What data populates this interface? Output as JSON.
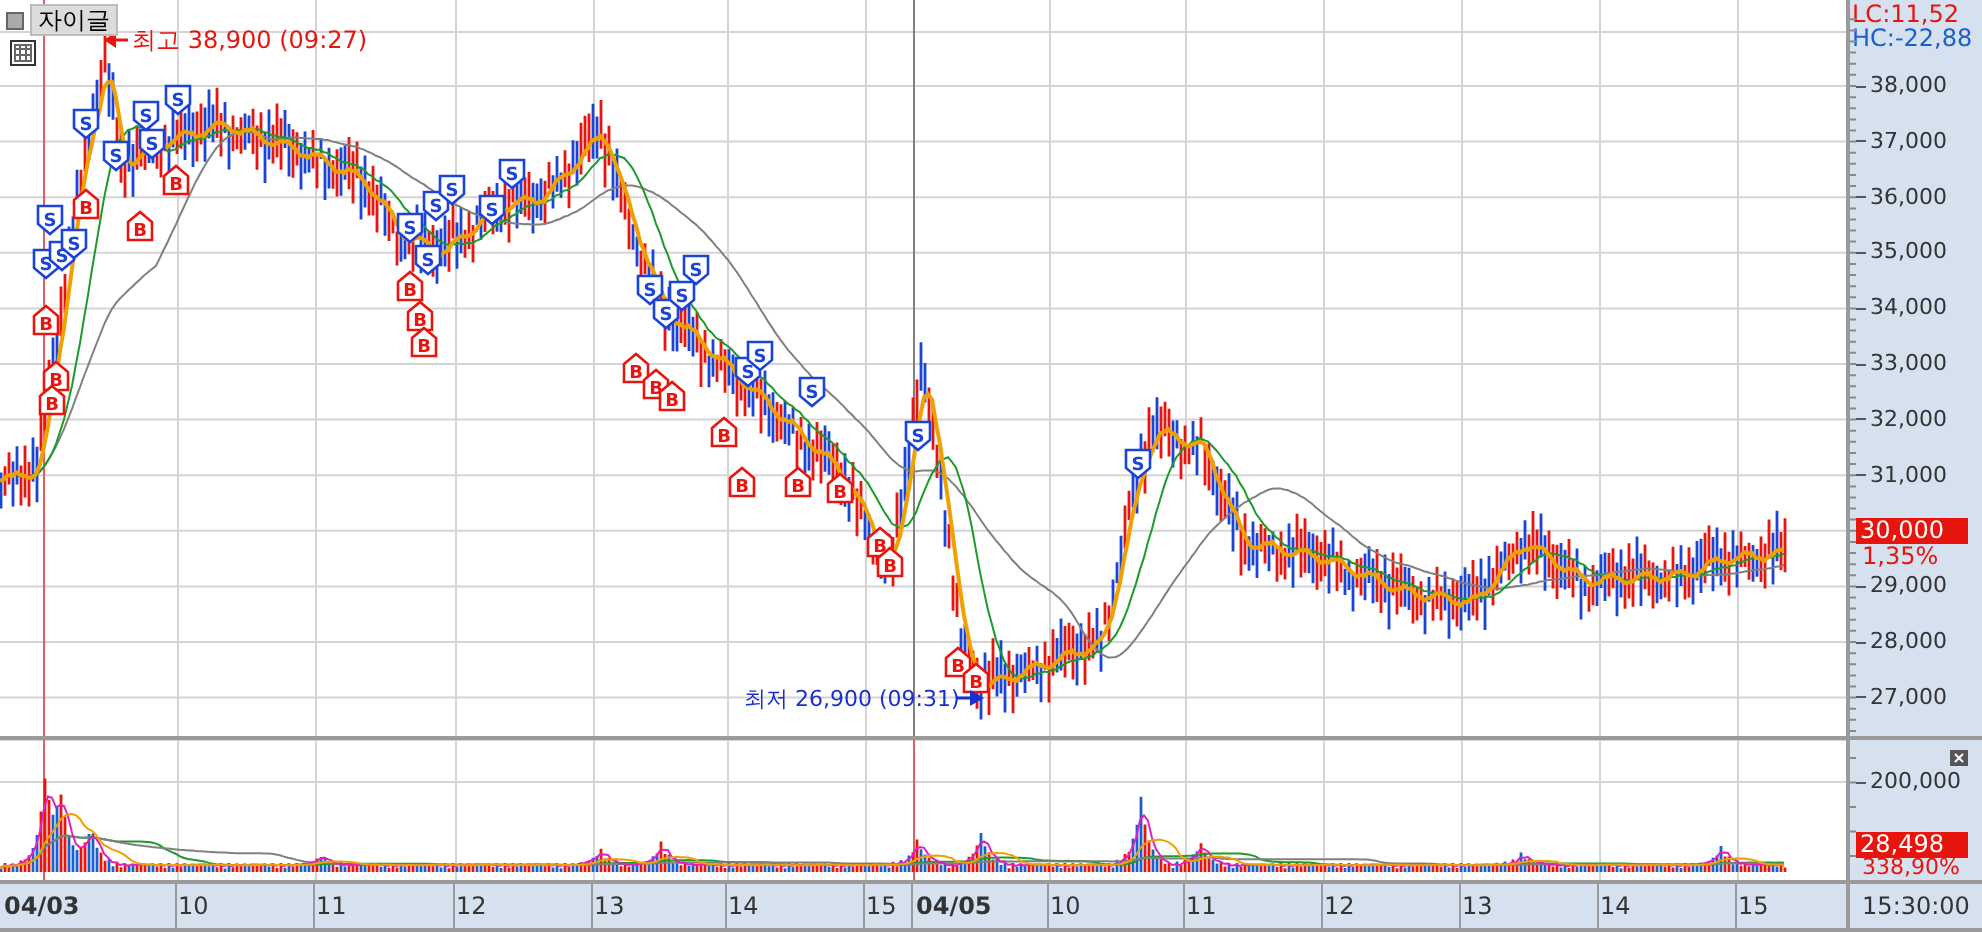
{
  "title": "자이글",
  "high_note": {
    "label": "최고 38,900 (09:27)"
  },
  "low_note": {
    "label": "최저 26,900 (09:31)"
  },
  "lc": "LC:11,52",
  "hc": "HC:-22,88",
  "price_axis": {
    "ticks": [
      "38,000",
      "37,000",
      "36,000",
      "35,000",
      "34,000",
      "33,000",
      "32,000",
      "31,000",
      "29,000",
      "28,000",
      "27,000"
    ],
    "current": "30,000",
    "change": "1,35%"
  },
  "volume_axis": {
    "ticks": [
      "200,000"
    ],
    "current": "28,498",
    "change": "338,90%"
  },
  "time_axis": [
    {
      "text": "04/03",
      "kind": "date"
    },
    {
      "text": "10",
      "kind": "hour"
    },
    {
      "text": "11",
      "kind": "hour"
    },
    {
      "text": "12",
      "kind": "hour"
    },
    {
      "text": "13",
      "kind": "hour"
    },
    {
      "text": "14",
      "kind": "hour"
    },
    {
      "text": "15",
      "kind": "hour"
    },
    {
      "text": "04/05",
      "kind": "date"
    },
    {
      "text": "10",
      "kind": "hour"
    },
    {
      "text": "11",
      "kind": "hour"
    },
    {
      "text": "12",
      "kind": "hour"
    },
    {
      "text": "13",
      "kind": "hour"
    },
    {
      "text": "14",
      "kind": "hour"
    },
    {
      "text": "15",
      "kind": "hour"
    }
  ],
  "time_corner": "15:30:00",
  "signals": [
    {
      "kind": "sell",
      "label": "S"
    },
    {
      "kind": "sell",
      "label": "S"
    },
    {
      "kind": "sell",
      "label": "S"
    },
    {
      "kind": "sell",
      "label": "S"
    },
    {
      "kind": "sell",
      "label": "S"
    },
    {
      "kind": "sell",
      "label": "S"
    },
    {
      "kind": "sell",
      "label": "S"
    },
    {
      "kind": "sell",
      "label": "S"
    },
    {
      "kind": "sell",
      "label": "S"
    },
    {
      "kind": "sell",
      "label": "S"
    },
    {
      "kind": "sell",
      "label": "S"
    },
    {
      "kind": "sell",
      "label": "S"
    },
    {
      "kind": "sell",
      "label": "S"
    },
    {
      "kind": "sell",
      "label": "S"
    },
    {
      "kind": "sell",
      "label": "S"
    },
    {
      "kind": "sell",
      "label": "S"
    },
    {
      "kind": "sell",
      "label": "S"
    },
    {
      "kind": "sell",
      "label": "S"
    },
    {
      "kind": "sell",
      "label": "S"
    },
    {
      "kind": "sell",
      "label": "S"
    },
    {
      "kind": "sell",
      "label": "S"
    },
    {
      "kind": "sell",
      "label": "S"
    },
    {
      "kind": "sell",
      "label": "S"
    },
    {
      "kind": "sell",
      "label": "S"
    },
    {
      "kind": "buy",
      "label": "B"
    },
    {
      "kind": "buy",
      "label": "B"
    },
    {
      "kind": "buy",
      "label": "B"
    },
    {
      "kind": "buy",
      "label": "B"
    },
    {
      "kind": "buy",
      "label": "B"
    },
    {
      "kind": "buy",
      "label": "B"
    },
    {
      "kind": "buy",
      "label": "B"
    },
    {
      "kind": "buy",
      "label": "B"
    },
    {
      "kind": "buy",
      "label": "B"
    },
    {
      "kind": "buy",
      "label": "B"
    },
    {
      "kind": "buy",
      "label": "B"
    },
    {
      "kind": "buy",
      "label": "B"
    },
    {
      "kind": "buy",
      "label": "B"
    },
    {
      "kind": "buy",
      "label": "B"
    },
    {
      "kind": "buy",
      "label": "B"
    },
    {
      "kind": "buy",
      "label": "B"
    },
    {
      "kind": "buy",
      "label": "B"
    },
    {
      "kind": "buy",
      "label": "B"
    },
    {
      "kind": "buy",
      "label": "B"
    },
    {
      "kind": "buy",
      "label": "B"
    }
  ]
}
